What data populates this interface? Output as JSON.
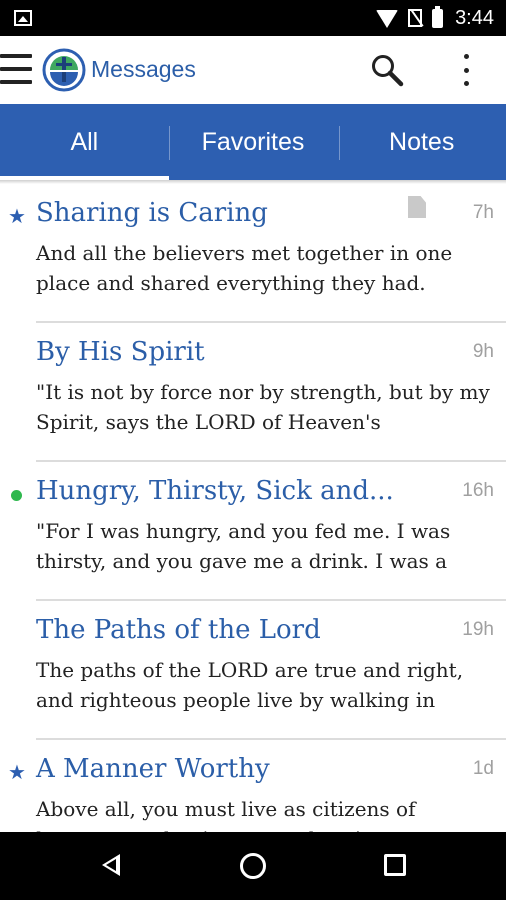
{
  "status_bar": {
    "time": "3:44"
  },
  "app_bar": {
    "title": "Messages"
  },
  "tabs": [
    {
      "label": "All",
      "active": true
    },
    {
      "label": "Favorites",
      "active": false
    },
    {
      "label": "Notes",
      "active": false
    }
  ],
  "messages": [
    {
      "title": "Sharing is Caring",
      "time": "7h",
      "marker": "star",
      "has_note": true,
      "preview": "And all the believers met together in one place and shared everything they had."
    },
    {
      "title": "By His Spirit",
      "time": "9h",
      "marker": "none",
      "has_note": false,
      "preview": "\"It is not by force nor by strength, but by my Spirit, says the LORD of Heaven's"
    },
    {
      "title": "Hungry, Thirsty, Sick and...",
      "time": "16h",
      "marker": "unread-dot",
      "has_note": false,
      "preview": "\"For I was hungry, and you fed me. I was thirsty, and you gave me a drink. I was a"
    },
    {
      "title": "The Paths of the Lord",
      "time": "19h",
      "marker": "none",
      "has_note": false,
      "preview": "The paths of the LORD are true and right, and righteous people live by walking in"
    },
    {
      "title": "A Manner Worthy",
      "time": "1d",
      "marker": "star",
      "has_note": false,
      "preview": "Above all, you must live as citizens of heaven, conducting yourselves in a manner"
    }
  ],
  "colors": {
    "accent": "#2d5fb1",
    "title_blue": "#2b5ea8",
    "unread_green": "#2fb84e"
  },
  "icons": {
    "menu": "hamburger-icon",
    "search": "search-icon",
    "overflow": "more-vert-icon",
    "note": "note-icon",
    "star": "star-icon"
  }
}
